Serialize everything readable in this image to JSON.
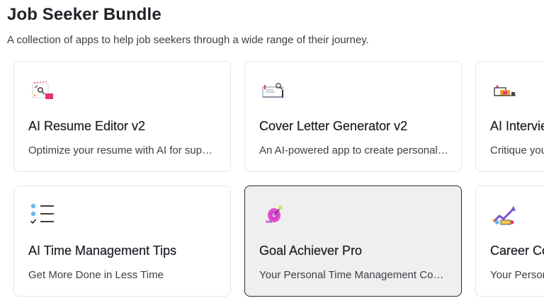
{
  "bundle": {
    "title": "Job Seeker Bundle",
    "description": "A collection of apps to help job seekers through a wide range of their journey."
  },
  "cards": [
    {
      "title": "AI Resume Editor v2",
      "description": "Optimize your resume with AI for super-charged results",
      "icon": "resume-editor-icon"
    },
    {
      "title": "Cover Letter Generator v2",
      "description": "An AI-powered app to create personalized cover letters",
      "icon": "cover-letter-icon"
    },
    {
      "title": "AI Interview Coach",
      "description": "Critique your interview answers with AI feedback",
      "icon": "interview-icon"
    },
    {
      "title": "AI Time Management Tips",
      "description": "Get More Done in Less Time",
      "icon": "checklist-icon"
    },
    {
      "title": "Goal Achiever Pro",
      "description": "Your Personal Time Management Coach",
      "icon": "target-icon"
    },
    {
      "title": "Career Coach",
      "description": "Your Personal Career Advisor",
      "icon": "career-growth-icon"
    }
  ],
  "colors": {
    "card_border": "#e3e5e8",
    "selected_background": "#efefef",
    "selected_border": "#2b2b2b",
    "accent_pink": "#e8336d",
    "accent_purple": "#7b4fd6",
    "accent_blue": "#6cb8f0"
  }
}
